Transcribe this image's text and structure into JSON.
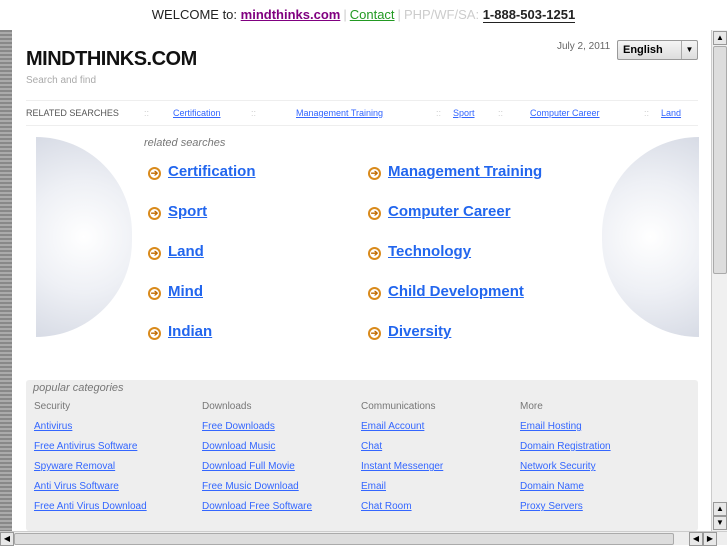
{
  "topbar": {
    "welcome": "WELCOME to:",
    "site": "mindthinks.com",
    "contact": "Contact",
    "label": "PHP/WF/SA:",
    "phone": "1-888-503-1251"
  },
  "header": {
    "logo": "MINDTHINKS.COM",
    "tagline": "Search and find",
    "date": "July 2, 2011",
    "language": "English"
  },
  "related_bar": {
    "heading": "RELATED SEARCHES",
    "links": [
      "Certification",
      "Management Training",
      "Sport",
      "Computer Career",
      "Land"
    ]
  },
  "related": {
    "title": "related searches",
    "left": [
      "Certification",
      "Sport",
      "Land",
      "Mind",
      "Indian"
    ],
    "right": [
      "Management Training",
      "Computer Career",
      "Technology",
      "Child Development",
      "Diversity"
    ]
  },
  "popular": {
    "title": "popular categories",
    "columns": [
      {
        "heading": "Security",
        "links": [
          "Antivirus",
          "Free Antivirus Software",
          "Spyware Removal",
          "Anti Virus Software",
          "Free Anti Virus Download"
        ]
      },
      {
        "heading": "Downloads",
        "links": [
          "Free Downloads",
          "Download Music",
          "Download Full Movie",
          "Free Music Download",
          "Download Free Software"
        ]
      },
      {
        "heading": "Communications",
        "links": [
          "Email Account",
          "Chat",
          "Instant Messenger",
          "Email",
          "Chat Room"
        ]
      },
      {
        "heading": "More",
        "links": [
          "Email Hosting",
          "Domain Registration",
          "Network Security",
          "Domain Name",
          "Proxy Servers"
        ]
      }
    ]
  }
}
